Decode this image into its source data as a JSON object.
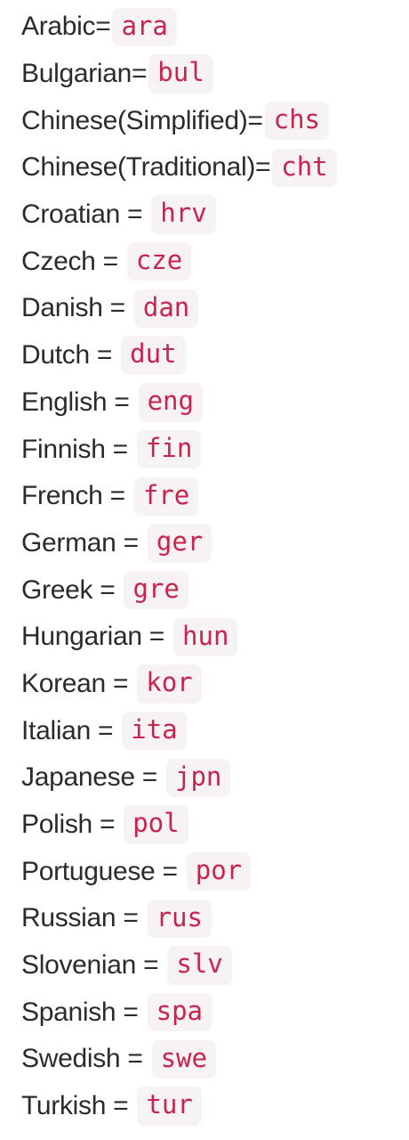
{
  "languages": [
    {
      "label": "Arabic=",
      "code": "ara"
    },
    {
      "label": "Bulgarian=",
      "code": "bul"
    },
    {
      "label": "Chinese(Simplified)=",
      "code": "chs"
    },
    {
      "label": "Chinese(Traditional)=",
      "code": "cht"
    },
    {
      "label": "Croatian = ",
      "code": "hrv"
    },
    {
      "label": "Czech = ",
      "code": "cze"
    },
    {
      "label": "Danish = ",
      "code": "dan"
    },
    {
      "label": "Dutch = ",
      "code": "dut"
    },
    {
      "label": "English = ",
      "code": "eng"
    },
    {
      "label": "Finnish = ",
      "code": "fin"
    },
    {
      "label": "French = ",
      "code": "fre"
    },
    {
      "label": "German = ",
      "code": "ger"
    },
    {
      "label": "Greek = ",
      "code": "gre"
    },
    {
      "label": "Hungarian = ",
      "code": "hun"
    },
    {
      "label": "Korean = ",
      "code": "kor"
    },
    {
      "label": "Italian = ",
      "code": "ita"
    },
    {
      "label": "Japanese = ",
      "code": "jpn"
    },
    {
      "label": "Polish = ",
      "code": "pol"
    },
    {
      "label": "Portuguese = ",
      "code": "por"
    },
    {
      "label": "Russian = ",
      "code": "rus"
    },
    {
      "label": "Slovenian = ",
      "code": "slv"
    },
    {
      "label": "Spanish = ",
      "code": "spa"
    },
    {
      "label": "Swedish = ",
      "code": "swe"
    },
    {
      "label": "Turkish = ",
      "code": "tur"
    }
  ],
  "colors": {
    "text": "#2b2b2b",
    "code_text": "#c7254e",
    "code_background": "#f7f2f3"
  }
}
